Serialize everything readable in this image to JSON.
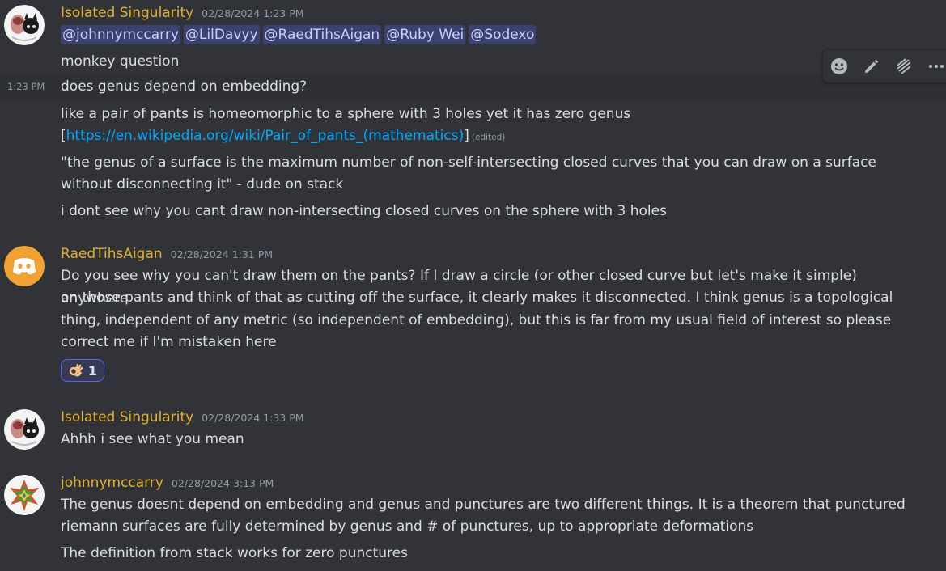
{
  "messages": [
    {
      "author": "Isolated Singularity",
      "time": "02/28/2024 1:23 PM",
      "mentions": [
        "@johnnymccarry",
        "@LilDavyy",
        "@RaedTihsAigan",
        "@Ruby Wei",
        "@Sodexo"
      ],
      "line1": "monkey question",
      "side_time": "1:23 PM",
      "line2": "does genus depend on embedding?",
      "line3": "like a pair of pants is homeomorphic to a sphere with 3 holes yet it has zero genus",
      "link_open": "[",
      "link": "https://en.wikipedia.org/wiki/Pair_of_pants_(mathematics)",
      "link_close": "]",
      "edited": "(edited)",
      "line4a": "\"the genus of a surface is the maximum number of non-self-intersecting closed curves that you can draw on a surface",
      "line4b": "without disconnecting it\" - dude on stack",
      "line5": "i dont see why you cant draw non-intersecting closed curves on the sphere with 3 holes"
    },
    {
      "author": "RaedTihsAigan",
      "time": "02/28/2024 1:31 PM",
      "line1": "Do you see why you can't draw them on the pants? If I draw a circle (or other closed curve but let's make it simple) anywhere",
      "line2": "on those pants and think of that as cutting off the surface, it clearly makes it disconnected. I think genus is a topological",
      "line3": "thing, independent of any metric (so independent of embedding), but this is far from my usual field of interest so please",
      "line4": "correct me if I'm mistaken here",
      "reaction": {
        "emoji": "ok-hand",
        "count": "1"
      }
    },
    {
      "author": "Isolated Singularity",
      "time": "02/28/2024 1:33 PM",
      "line1": "Ahhh i see what you mean"
    },
    {
      "author": "johnnymccarry",
      "time": "02/28/2024 3:13 PM",
      "line1": "The genus doesnt depend on embedding and genus and punctures are two different things. It is a theorem that punctured",
      "line2": "riemann surfaces are fully determined by genus and # of punctures, up to appropriate deformations",
      "line3": "The definition from stack works for zero punctures"
    }
  ],
  "toolbar": {
    "icons": [
      "add-reaction-icon",
      "edit-icon",
      "create-thread-icon",
      "more-icon"
    ]
  },
  "colors": {
    "background": "#313338",
    "author": "#e1b12c",
    "link": "#00a8fc",
    "mention_bg": "#3c4270",
    "discord_blurple": "#5865f2"
  }
}
